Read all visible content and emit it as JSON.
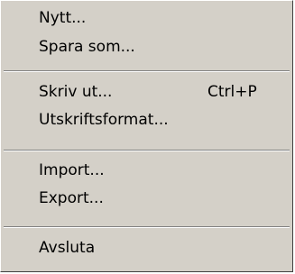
{
  "menu": {
    "items": [
      {
        "label": "Nytt..."
      },
      {
        "label": "Spara som..."
      },
      {
        "label": "Skriv ut...",
        "shortcut": "Ctrl+P"
      },
      {
        "label": "Utskriftsformat..."
      },
      {
        "label": "Import..."
      },
      {
        "label": "Export..."
      },
      {
        "label": "Avsluta"
      }
    ]
  },
  "colors": {
    "menu_background": "#d4d0c8",
    "separator_dark": "#808080",
    "separator_light": "#ffffff",
    "text": "#000000"
  }
}
